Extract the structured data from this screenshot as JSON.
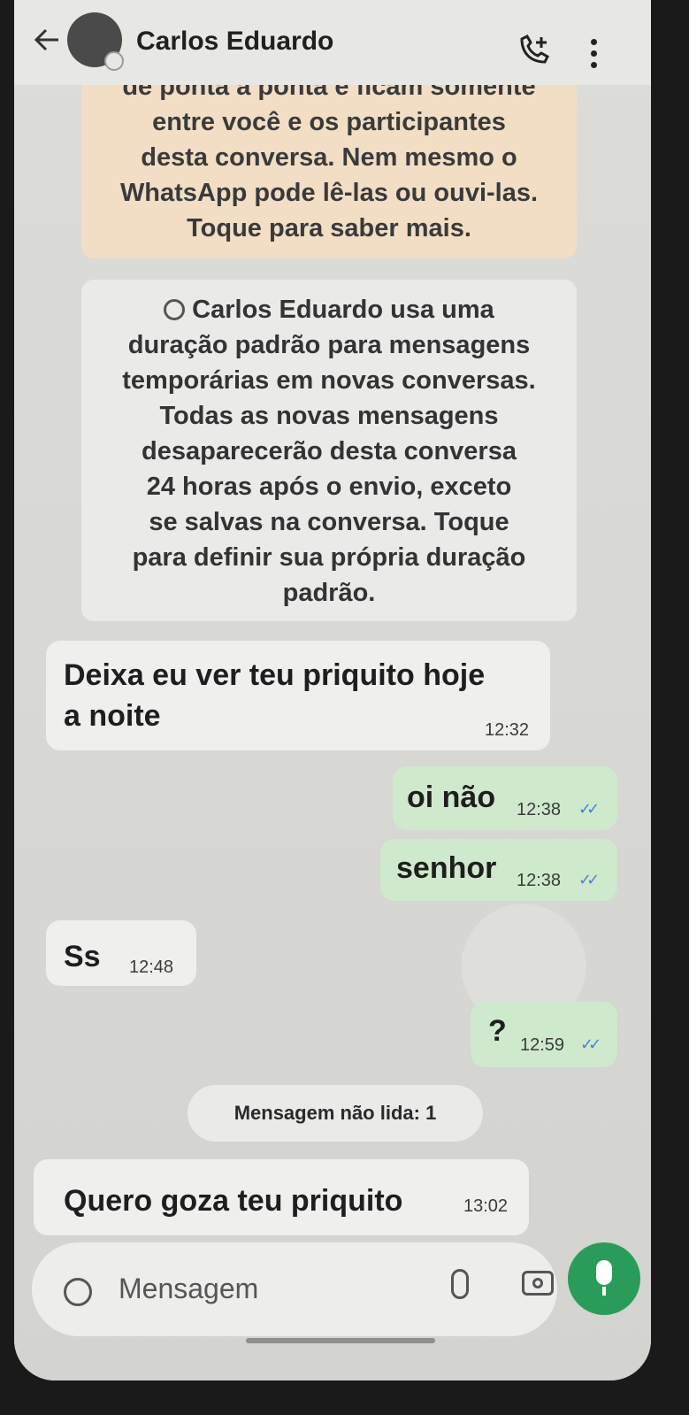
{
  "header": {
    "contact_name": "Carlos Eduardo"
  },
  "encryption_notice": {
    "lines": [
      "de ponta a ponta e ficam somente",
      "entre você e os participantes",
      "desta conversa. Nem mesmo o",
      "WhatsApp pode lê-las ou ouvi-las.",
      "Toque para saber mais."
    ]
  },
  "system_notice": {
    "lines": [
      "Carlos Eduardo usa uma",
      "duração padrão para mensagens",
      "temporárias em novas conversas.",
      "Todas as novas mensagens",
      "desaparecerão desta conversa",
      "24 horas após o envio, exceto",
      "se salvas na conversa. Toque",
      "para definir sua própria duração",
      "padrão."
    ]
  },
  "messages": [
    {
      "direction": "in",
      "text_line1": "Deixa eu ver teu priquito hoje",
      "text_line2": "a noite",
      "time": "12:32"
    },
    {
      "direction": "out",
      "text": "oi não",
      "time": "12:38",
      "status": "read"
    },
    {
      "direction": "out",
      "text": "senhor",
      "time": "12:38",
      "status": "read"
    },
    {
      "direction": "in",
      "text": "Ss",
      "time": "12:48"
    },
    {
      "direction": "out",
      "text": "?",
      "time": "12:59",
      "status": "read"
    },
    {
      "direction": "in",
      "text": "Quero goza teu priquito",
      "time": "13:02"
    }
  ],
  "unread_divider": "Mensagem não lida: 1",
  "composer": {
    "placeholder": "Mensagem"
  },
  "ticks_glyph": "✓✓"
}
